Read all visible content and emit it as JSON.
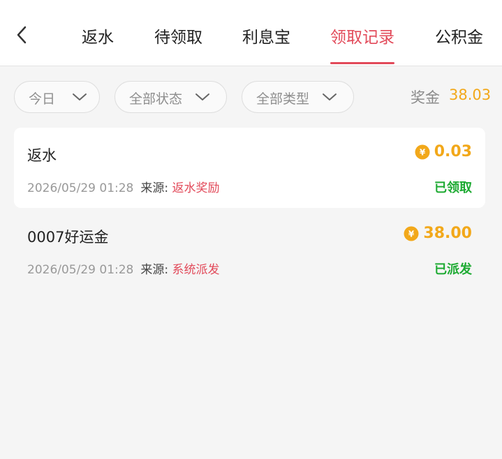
{
  "tabs": [
    "返水",
    "待领取",
    "利息宝",
    "领取记录",
    "公积金"
  ],
  "active_tab": "领取记录",
  "filters": {
    "date": "今日",
    "status": "全部状态",
    "type": "全部类型"
  },
  "bonus": {
    "label": "奖金",
    "value": "38.03"
  },
  "records": [
    {
      "title": "返水",
      "datetime": "2026/05/29 01:28",
      "source_label": "来源:",
      "source_value": "返水奖励",
      "amount": "0.03",
      "status": "已领取"
    },
    {
      "title": "0007好运金",
      "datetime": "2026/05/29 01:28",
      "source_label": "来源:",
      "source_value": "系统派发",
      "amount": "38.00",
      "status": "已派发"
    }
  ],
  "colors": {
    "accent": "#e24a5a",
    "gold": "#f2a81a",
    "success": "#1daa32"
  },
  "icons": {
    "back": "chevron-left-icon",
    "dropdown": "chevron-down-icon",
    "coin": "yuan-coin-icon"
  }
}
